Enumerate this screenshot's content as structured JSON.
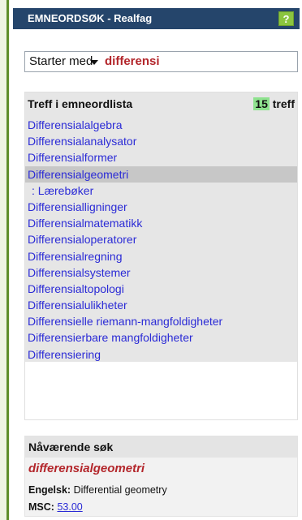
{
  "header": {
    "title": "EMNEORDSØK - Realfag",
    "help_glyph": "?"
  },
  "search": {
    "mode": "Starter med",
    "query": "differensi"
  },
  "hits": {
    "heading": "Treff i emneordlista",
    "count": "15",
    "count_suffix": "treff",
    "items": [
      "Differensialalgebra",
      "Differensialanalysator",
      "Differensialformer",
      "Differensialgeometri",
      ": Lærebøker",
      "Differensialligninger",
      "Differensialmatematikk",
      "Differensialoperatorer",
      "Differensialregning",
      "Differensialsystemer",
      "Differensialtopologi",
      "Differensialulikheter",
      "Differensielle riemann-mangfoldigheter",
      "Differensierbare mangfoldigheter",
      "Differensiering"
    ]
  },
  "current": {
    "heading": "Nåværende søk",
    "term": "differensialgeometri",
    "english_label": "Engelsk:",
    "english_value": "Differential geometry",
    "msc_label": "MSC:",
    "msc_value": "53.00"
  },
  "colors": {
    "header_bg": "#25456b",
    "help_bg": "#8bc53f",
    "link": "#2b2bd6",
    "term": "#b3262b",
    "count_highlight": "#8ee28e"
  }
}
